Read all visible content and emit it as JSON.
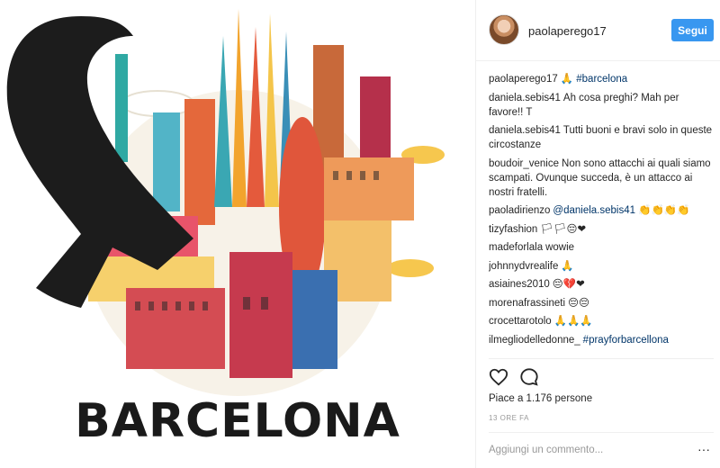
{
  "image": {
    "caption_text": "BARCELONA",
    "icons": [
      "mourning-ribbon-icon",
      "barcelona-skyline-illustration"
    ]
  },
  "header": {
    "username": "paolaperego17",
    "follow_label": "Segui"
  },
  "comments": [
    {
      "user": "paolaperego17",
      "link": "🙏 #barcelona",
      "text": ""
    },
    {
      "user": "daniela.sebis41",
      "link": "",
      "text": "Ah cosa preghi? Mah per favore!! T"
    },
    {
      "user": "daniela.sebis41",
      "link": "",
      "text": "Tutti buoni e bravi solo in queste circostanze"
    },
    {
      "user": "boudoir_venice",
      "link": "",
      "text": "Non sono attacchi ai quali siamo scampati. Ovunque succeda, è un attacco ai nostri fratelli."
    },
    {
      "user": "paoladirienzo",
      "link": "@daniela.sebis41",
      "text": "👏👏👏👏"
    },
    {
      "user": "tizyfashion",
      "link": "",
      "text": "🏳🏳😔❤"
    },
    {
      "user": "madeforlala",
      "link": "",
      "text": "wowie"
    },
    {
      "user": "johnnydvrealife",
      "link": "",
      "text": "🙏"
    },
    {
      "user": "asiaines2010",
      "link": "",
      "text": "😔💔❤"
    },
    {
      "user": "morenafrassineti",
      "link": "",
      "text": "😔😔"
    },
    {
      "user": "crocettarotolo",
      "link": "",
      "text": "🙏🙏🙏"
    },
    {
      "user": "ilmegliodelledonne_",
      "link": "#prayforbarcellona",
      "text": ""
    }
  ],
  "actions": {
    "like_icon": "heart-icon",
    "comment_icon": "comment-bubble-icon"
  },
  "likes_text": "Piace a 1.176 persone",
  "time_ago": "13 ORE FA",
  "comment_input": {
    "placeholder": "Aggiungi un commento..."
  },
  "more_label": "···",
  "colors": {
    "follow_button": "#3897f0",
    "link": "#003569",
    "ribbon": "#1c1c1c"
  }
}
